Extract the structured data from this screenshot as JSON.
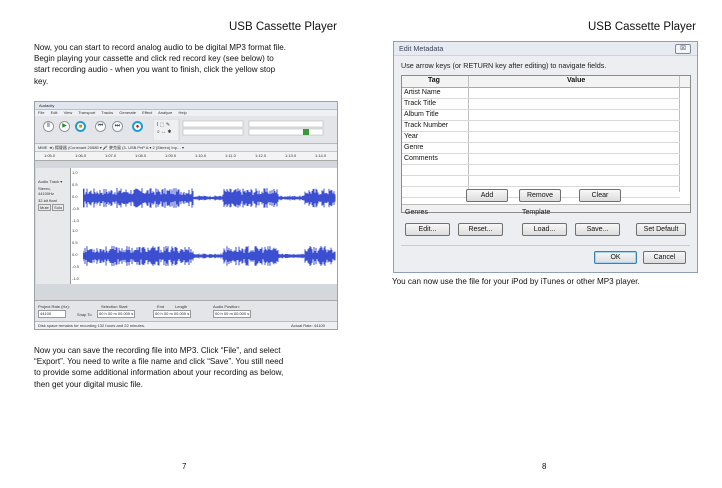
{
  "page7": {
    "header": "USB Cassette Player",
    "intro_lines": [
      "Now, you can start to record analog audio to be digital MP3 format file.",
      "Begin playing your cassette and click red record key (see below) to",
      "start recording audio - when you want to finish, click the yellow stop",
      "key."
    ],
    "save_lines": [
      "Now you can save the recording file into MP3. Click “File”, and select",
      "“Export”. You need to write a file name and click “Save”. You still need",
      "to provide some additional information about your recording as below,",
      "then get your digital music file."
    ],
    "page_number": "7"
  },
  "audacity": {
    "window_title": "Audacity",
    "menu": [
      "File",
      "Edit",
      "View",
      "Transport",
      "Tracks",
      "Generate",
      "Effect",
      "Analyze",
      "Help"
    ],
    "transport": [
      {
        "icon": "pause-icon",
        "glyph": "Ⅱ",
        "highlight": false
      },
      {
        "icon": "play-icon",
        "glyph": "▶",
        "highlight": false
      },
      {
        "icon": "stop-icon",
        "glyph": "■",
        "highlight": true
      },
      {
        "icon": "skip-start-icon",
        "glyph": "⏮",
        "highlight": false
      },
      {
        "icon": "skip-end-icon",
        "glyph": "⏭",
        "highlight": false
      },
      {
        "icon": "record-icon",
        "glyph": "●",
        "highlight": true
      }
    ],
    "device_bar": "MME   ◄) 揚聲器 (Conexant 20585 ▾  🎤 麥克風 (3- USB PnP A ▾  2 (Stereo) Inp… ▾",
    "ruler": [
      "1:05.0",
      "1:06.0",
      "1:07.0",
      "1:08.0",
      "1:09.0",
      "1:10.0",
      "1:11.0",
      "1:12.0",
      "1:13.0",
      "1:14.0"
    ],
    "track_label": "Audio Track ▾",
    "track_info": [
      "Stereo, 44100Hz",
      "32-bit float"
    ],
    "mute": "Mute",
    "solo": "Solo",
    "scale": [
      "1.0",
      "0.5",
      "0.0",
      "-0.5",
      "-1.0"
    ],
    "project_rate_label": "Project Rate (Hz):",
    "project_rate": "44100",
    "snap_label": "Snap To",
    "selection_start_label": "Selection Start:",
    "end_label": "End",
    "length_label": "Length",
    "audio_position_label": "Audio Position:",
    "time_value": "00 h 00 m 00.000 s",
    "status_left": "Disk space remains for recording 132 hours and 22 minutes.",
    "status_right": "Actual Rate: 44100"
  },
  "page8": {
    "header": "USB Cassette Player",
    "caption": "You can now use the file for your iPod by iTunes or other MP3 player.",
    "page_number": "8"
  },
  "dialog": {
    "title": "Edit Metadata",
    "close": "☒",
    "hint": "Use arrow keys (or RETURN key after editing) to navigate fields.",
    "col_tag": "Tag",
    "col_value": "Value",
    "rows": [
      "Artist Name",
      "Track Title",
      "Album Title",
      "Track Number",
      "Year",
      "Genre",
      "Comments"
    ],
    "add": "Add",
    "remove": "Remove",
    "clear": "Clear",
    "genres_label": "Genres",
    "genres_edit": "Edit...",
    "genres_reset": "Reset...",
    "template_label": "Template",
    "template_load": "Load...",
    "template_save": "Save...",
    "template_default": "Set Default",
    "ok": "OK",
    "cancel": "Cancel"
  },
  "colors": {
    "waveform": "#3b4fd0",
    "highlight_ring": "#1d9fd6"
  }
}
